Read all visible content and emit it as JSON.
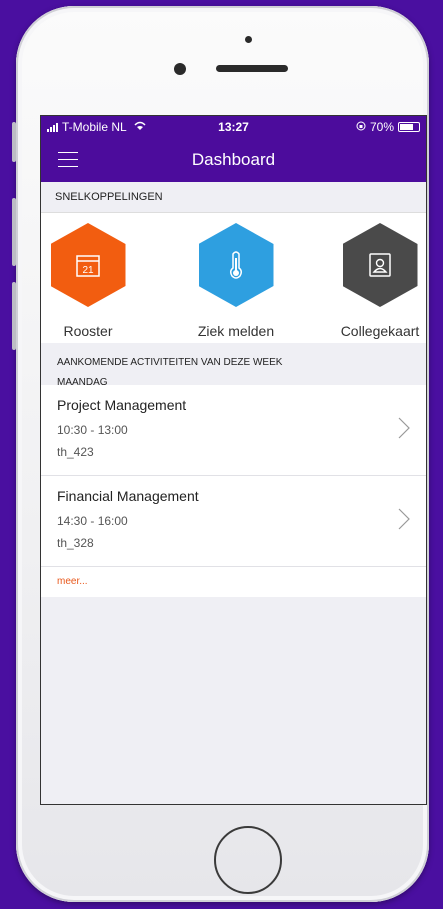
{
  "status_bar": {
    "carrier": "T-Mobile NL",
    "time": "13:27",
    "battery_text": "70%",
    "battery_level": 0.7
  },
  "nav": {
    "title": "Dashboard"
  },
  "shortcuts_section": {
    "header": "SNELKOPPELINGEN",
    "items": [
      {
        "label": "Rooster",
        "icon": "calendar-icon",
        "icon_text": "21",
        "color": "#f25d10"
      },
      {
        "label": "Ziek melden",
        "icon": "thermometer-icon",
        "color": "#2e9fe0"
      },
      {
        "label": "Collegekaart",
        "icon": "id-card-icon",
        "color": "#4a4a4a"
      }
    ]
  },
  "activities_section": {
    "header": "AANKOMENDE ACTIVITEITEN VAN DEZE WEEK",
    "day": "MAANDAG",
    "items": [
      {
        "title": "Project Management",
        "time": "10:30 - 13:00",
        "room": "th_423"
      },
      {
        "title": "Financial Management",
        "time": "14:30 - 16:00",
        "room": "th_328"
      }
    ],
    "more_label": "meer..."
  },
  "colors": {
    "brand": "#4c0c9c",
    "background": "#4a0fa0",
    "accent": "#e8581c"
  }
}
